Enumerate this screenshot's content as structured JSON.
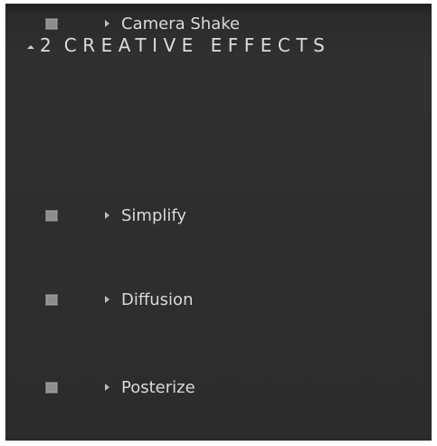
{
  "panel": {
    "group_number": "2",
    "title": "CREATIVE EFFECTS",
    "collapse_icon": "triangle-up-icon",
    "items": [
      {
        "label": "Simplify",
        "enabled": false
      },
      {
        "label": "Diffusion",
        "enabled": false
      },
      {
        "label": "Posterize",
        "enabled": false
      },
      {
        "label": "Camera Shake",
        "enabled": false
      }
    ]
  },
  "colors": {
    "panel_background": "#2e2e2e",
    "text": "#d9d9d9",
    "checkbox": "#8d8d8d"
  }
}
